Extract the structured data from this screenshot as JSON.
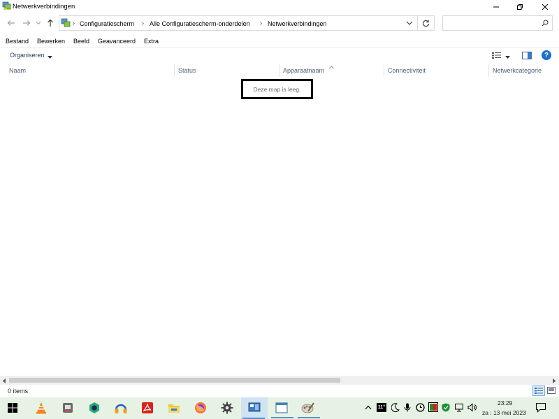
{
  "window": {
    "title": "Netwerkverbindingen",
    "controls": [
      "minimize",
      "restore",
      "close"
    ]
  },
  "navigation": {
    "breadcrumbs": [
      "Configuratiescherm",
      "Alle Configuratiescherm-onderdelen",
      "Netwerkverbindingen"
    ],
    "search_placeholder": ""
  },
  "menubar": [
    "Bestand",
    "Bewerken",
    "Beeld",
    "Geavanceerd",
    "Extra"
  ],
  "commandbar": {
    "organize_label": "Organiseren"
  },
  "columns": [
    "Naam",
    "Status",
    "Apparaatnaam",
    "Connectiviteit",
    "Netwerkcategorie"
  ],
  "content": {
    "empty_message": "Deze map is leeg."
  },
  "statusbar": {
    "item_count": "0 items"
  },
  "taskbar": {
    "apps": [
      "vlc-icon",
      "media-player-icon",
      "package-icon",
      "headphones-icon",
      "pdf-icon",
      "file-explorer-icon",
      "firefox-icon",
      "settings-icon",
      "control-panel-icon",
      "window-icon",
      "paint-icon"
    ],
    "tray": {
      "weather": "11°",
      "time": "23:29",
      "date": "za : 13 mei 2023"
    }
  },
  "colors": {
    "accent": "#0a64c8",
    "taskbar_bg": "#e6f2e3",
    "selection": "#5a8fc9"
  }
}
